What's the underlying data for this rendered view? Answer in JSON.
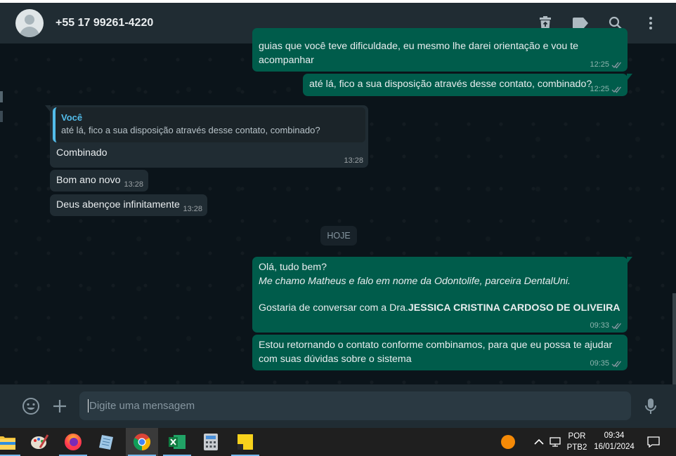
{
  "header": {
    "contact_name": "+55 17 99261-4220",
    "icons": [
      "delete-icon",
      "label-icon",
      "search-icon",
      "menu-icon"
    ]
  },
  "messages": [
    {
      "direction": "out",
      "text_lines": [
        "guias que você teve dificuldade, eu mesmo lhe darei orientação e vou te",
        "acompanhar"
      ],
      "time": "12:25",
      "status": "read"
    },
    {
      "direction": "out",
      "text": "até lá, fico a sua disposição através desse contato, combinado?",
      "time": "12:25",
      "status": "read"
    },
    {
      "direction": "in",
      "quote_author": "Você",
      "quote_text": "até lá, fico a sua disposição através desse contato, combinado?",
      "text": "Combinado",
      "time": "13:28"
    },
    {
      "direction": "in",
      "text": "Bom ano novo",
      "time": "13:28"
    },
    {
      "direction": "in",
      "text": "Deus abençoe infinitamente",
      "time": "13:28"
    },
    {
      "direction": "out",
      "line1": "Olá, tudo bem?",
      "line2_italic": "Me chamo Matheus e falo em nome da Odontolife, parceira DentalUni.",
      "line3_prefix": "Gostaria de conversar com a Dra.",
      "line3_bold": "JESSICA CRISTINA CARDOSO DE OLIVEIRA",
      "time": "09:33",
      "status": "read"
    },
    {
      "direction": "out",
      "text_lines": [
        "Estou retornando o contato conforme combinamos, para que eu possa te ajudar",
        "com suas dúvidas sobre o sistema"
      ],
      "time": "09:35",
      "status": "read"
    }
  ],
  "date_separator": "HOJE",
  "composer": {
    "placeholder": "Digite uma mensagem"
  },
  "taskbar": {
    "apps": [
      "file-explorer-icon",
      "paint-icon",
      "firefox-icon",
      "notepad-icon",
      "chrome-icon",
      "excel-icon",
      "calculator-icon",
      "sticky-notes-icon"
    ],
    "active_app": "chrome-icon",
    "language_top": "POR",
    "language_bottom": "PTB2",
    "time": "09:34",
    "date": "16/01/2024"
  },
  "colors": {
    "header_bg": "#202c33",
    "chat_bg": "#0b141a",
    "outgoing_bubble": "#005c4b",
    "incoming_bubble": "#202c33",
    "quote_accent": "#53bdeb",
    "read_ticks": "#8696a0",
    "taskbar_bg": "#1f1f1f"
  }
}
